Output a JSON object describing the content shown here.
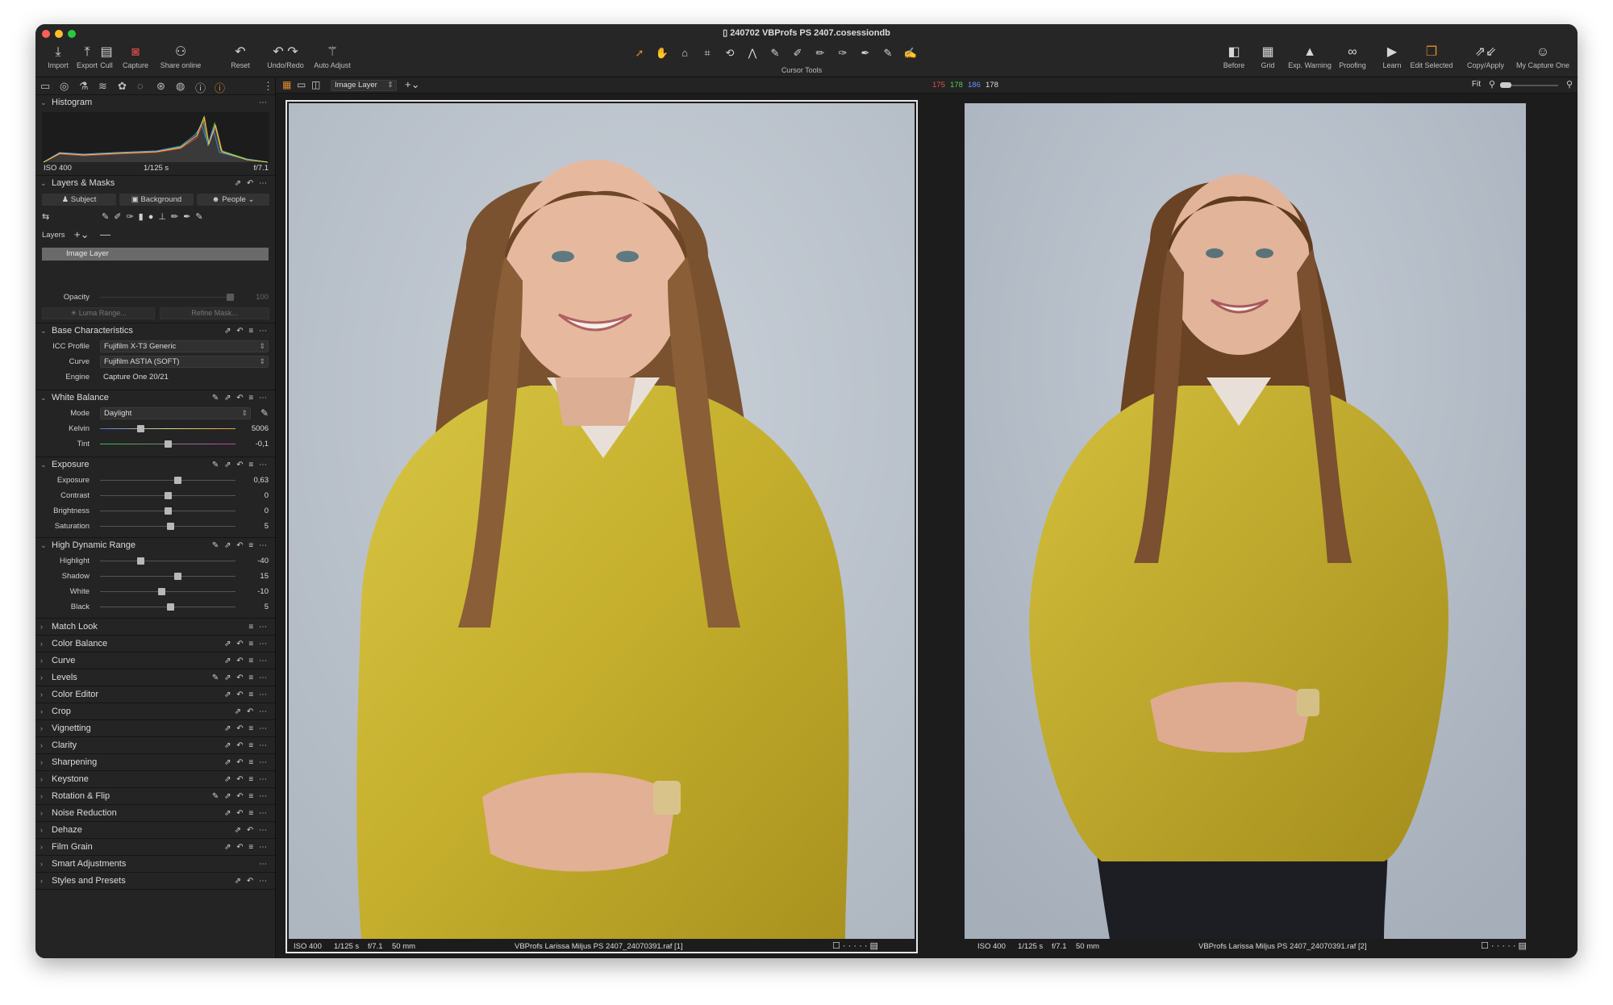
{
  "window": {
    "title": "240702 VBProfs PS 2407.cosessiondb"
  },
  "toolbar": {
    "left": [
      {
        "label": "Import",
        "icon": "import-icon"
      },
      {
        "label": "Export",
        "icon": "export-icon"
      },
      {
        "label": "Cull",
        "icon": "cull-icon"
      },
      {
        "label": "Capture",
        "icon": "capture-icon"
      },
      {
        "label": "Share online",
        "icon": "share-online-icon"
      },
      {
        "label": "Reset",
        "icon": "reset-icon"
      },
      {
        "label": "Undo/Redo",
        "icon": "undo-redo-icon"
      },
      {
        "label": "Auto Adjust",
        "icon": "auto-adjust-icon"
      }
    ],
    "cursor_tools_label": "Cursor Tools",
    "right": [
      {
        "label": "Before",
        "icon": "before-icon"
      },
      {
        "label": "Grid",
        "icon": "grid-icon"
      },
      {
        "label": "Exp. Warning",
        "icon": "exposure-warning-icon"
      },
      {
        "label": "Proofing",
        "icon": "proofing-icon"
      },
      {
        "label": "Learn",
        "icon": "learn-icon"
      },
      {
        "label": "Edit Selected",
        "icon": "edit-selected-icon"
      },
      {
        "label": "Copy/Apply",
        "icon": "copy-apply-icon"
      },
      {
        "label": "My Capture One",
        "icon": "my-capture-one-icon"
      }
    ]
  },
  "viewer_bar": {
    "layer_select": "Image Layer",
    "rgb": {
      "r": "175",
      "g": "178",
      "b": "186",
      "l": "178"
    },
    "zoom": "Fit"
  },
  "panel": {
    "histogram": {
      "title": "Histogram",
      "iso": "ISO 400",
      "shutter": "1/125 s",
      "aperture": "f/7.1"
    },
    "layers_masks": {
      "title": "Layers & Masks",
      "buttons": [
        "Subject",
        "Background",
        "People"
      ],
      "layers_label": "Layers",
      "layer_item": "Image Layer",
      "opacity_label": "Opacity",
      "opacity_value": "100",
      "luma_range": "Luma Range...",
      "refine_mask": "Refine Mask..."
    },
    "base": {
      "title": "Base Characteristics",
      "icc_label": "ICC Profile",
      "icc_value": "Fujifilm X-T3 Generic",
      "curve_label": "Curve",
      "curve_value": "Fujifilm ASTIA (SOFT)",
      "engine_label": "Engine",
      "engine_value": "Capture One 20/21"
    },
    "white_balance": {
      "title": "White Balance",
      "mode_label": "Mode",
      "mode_value": "Daylight",
      "kelvin_label": "Kelvin",
      "kelvin_value": "5006",
      "tint_label": "Tint",
      "tint_value": "-0,1"
    },
    "exposure": {
      "title": "Exposure",
      "rows": [
        {
          "label": "Exposure",
          "value": "0,63",
          "pos": 0.57
        },
        {
          "label": "Contrast",
          "value": "0",
          "pos": 0.5
        },
        {
          "label": "Brightness",
          "value": "0",
          "pos": 0.5
        },
        {
          "label": "Saturation",
          "value": "5",
          "pos": 0.52
        }
      ]
    },
    "hdr": {
      "title": "High Dynamic Range",
      "rows": [
        {
          "label": "Highlight",
          "value": "-40",
          "pos": 0.3
        },
        {
          "label": "Shadow",
          "value": "15",
          "pos": 0.57
        },
        {
          "label": "White",
          "value": "-10",
          "pos": 0.45
        },
        {
          "label": "Black",
          "value": "5",
          "pos": 0.52
        }
      ]
    },
    "tools": [
      "Match Look",
      "Color Balance",
      "Curve",
      "Levels",
      "Color Editor",
      "Crop",
      "Vignetting",
      "Clarity",
      "Sharpening",
      "Keystone",
      "Rotation & Flip",
      "Noise Reduction",
      "Dehaze",
      "Film Grain",
      "Smart Adjustments",
      "Styles and Presets"
    ]
  },
  "viewer": {
    "left_caption": {
      "iso": "ISO 400",
      "shutter": "1/125 s",
      "aperture": "f/7.1",
      "focal": "50 mm",
      "file": "VBProfs Larissa Miljus PS 2407_24070391.raf [1]"
    },
    "right_caption": {
      "iso": "ISO 400",
      "shutter": "1/125 s",
      "aperture": "f/7.1",
      "focal": "50 mm",
      "file": "VBProfs Larissa Miljus PS 2407_24070391.raf [2]"
    }
  },
  "colors": {
    "accent": "#e08a2c",
    "bg": "#1e1e1e",
    "panel": "#242424",
    "shirt": "#c8b532",
    "backdrop": "#bcc3cc"
  }
}
